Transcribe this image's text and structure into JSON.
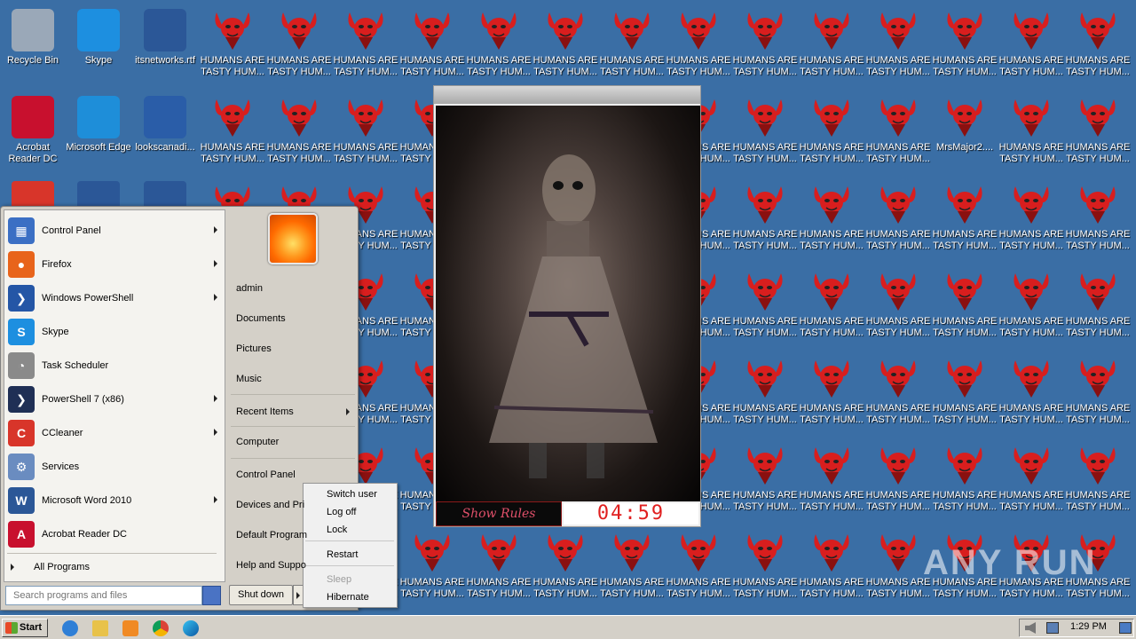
{
  "desktop": {
    "shortcut_icons": [
      {
        "label": "Recycle Bin"
      },
      {
        "label": "Skype"
      },
      {
        "label": "itsnetworks.rtf"
      },
      {
        "label": "Acrobat\nReader DC"
      },
      {
        "label": "Microsoft Edge"
      },
      {
        "label": "lookscanadi..."
      }
    ],
    "repeated_file_label": "HUMANS ARE\nTASTY HUM...",
    "renamed_file_label": "MrsMajor2....",
    "watermark": "ANY RUN"
  },
  "start_menu": {
    "programs": [
      {
        "label": "Control Panel",
        "submenu": true,
        "color": "#3b6fc4",
        "glyph": "▦"
      },
      {
        "label": "Firefox",
        "submenu": true,
        "color": "#e8641b",
        "glyph": "●"
      },
      {
        "label": "Windows PowerShell",
        "submenu": true,
        "color": "#2456a6",
        "glyph": "❯"
      },
      {
        "label": "Skype",
        "submenu": false,
        "color": "#1d8fe0",
        "glyph": "S"
      },
      {
        "label": "Task Scheduler",
        "submenu": false,
        "color": "#8a8a8a",
        "glyph": "◔"
      },
      {
        "label": "PowerShell 7 (x86)",
        "submenu": true,
        "color": "#1f2f55",
        "glyph": "❯"
      },
      {
        "label": "CCleaner",
        "submenu": true,
        "color": "#d8352a",
        "glyph": "C"
      },
      {
        "label": "Services",
        "submenu": false,
        "color": "#6a8cc0",
        "glyph": "⚙"
      },
      {
        "label": "Microsoft Word 2010",
        "submenu": true,
        "color": "#2b5797",
        "glyph": "W"
      },
      {
        "label": "Acrobat Reader DC",
        "submenu": false,
        "color": "#c8102e",
        "glyph": "A"
      }
    ],
    "all_programs": "All Programs",
    "search_placeholder": "Search programs and files",
    "right_items": [
      {
        "label": "admin",
        "submenu": false
      },
      {
        "label": "Documents",
        "submenu": false
      },
      {
        "label": "Pictures",
        "submenu": false
      },
      {
        "label": "Music",
        "submenu": false
      },
      {
        "label": "Recent Items",
        "submenu": true
      },
      {
        "label": "Computer",
        "submenu": false
      },
      {
        "label": "Control Panel",
        "submenu": false
      },
      {
        "label": "Devices and Pri",
        "submenu": false
      },
      {
        "label": "Default Program",
        "submenu": false
      },
      {
        "label": "Help and Suppo",
        "submenu": false
      }
    ],
    "shutdown_label": "Shut down",
    "shutdown_options": [
      {
        "label": "Switch user",
        "enabled": true
      },
      {
        "label": "Log off",
        "enabled": true
      },
      {
        "label": "Lock",
        "enabled": true
      },
      {
        "label": "Restart",
        "enabled": true
      },
      {
        "label": "Sleep",
        "enabled": false
      },
      {
        "label": "Hibernate",
        "enabled": true
      }
    ]
  },
  "ransom_window": {
    "show_rules_label": "Show Rules",
    "countdown": "04:59"
  },
  "taskbar": {
    "start_label": "Start",
    "clock": "1:29 PM",
    "quicklaunch": [
      "internet-explorer-icon",
      "explorer-folder-icon",
      "media-player-icon",
      "chrome-icon",
      "edge-icon"
    ]
  },
  "colors": {
    "desktop_bg": "#3a6ea5",
    "devil_red": "#d81e1e",
    "timer_red": "#e02020"
  }
}
